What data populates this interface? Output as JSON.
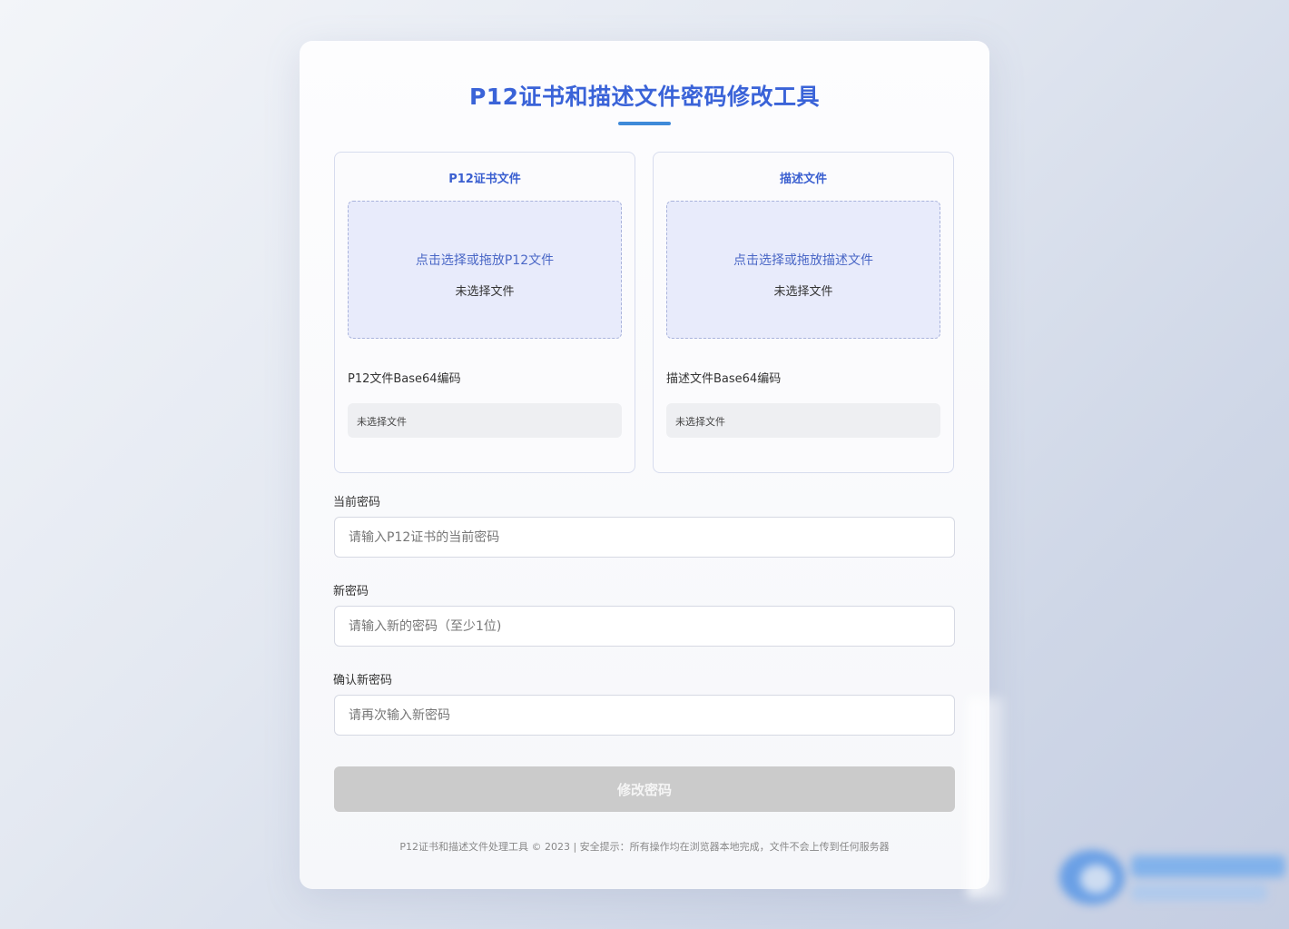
{
  "page": {
    "title": "P12证书和描述文件密码修改工具"
  },
  "p12_panel": {
    "title": "P12证书文件",
    "dropzone_hint": "点击选择或拖放P12文件",
    "dropzone_status": "未选择文件",
    "base64_label": "P12文件Base64编码",
    "base64_value": "未选择文件"
  },
  "profile_panel": {
    "title": "描述文件",
    "dropzone_hint": "点击选择或拖放描述文件",
    "dropzone_status": "未选择文件",
    "base64_label": "描述文件Base64编码",
    "base64_value": "未选择文件"
  },
  "form": {
    "current_password": {
      "label": "当前密码",
      "value": "",
      "placeholder": "请输入P12证书的当前密码"
    },
    "new_password": {
      "label": "新密码",
      "value": "",
      "placeholder": "请输入新的密码（至少1位)"
    },
    "confirm_password": {
      "label": "确认新密码",
      "value": "",
      "placeholder": "请再次输入新密码"
    },
    "submit_label": "修改密码",
    "submit_disabled": true
  },
  "footer": {
    "text": "P12证书和描述文件处理工具 © 2023 | 安全提示：所有操作均在浏览器本地完成，文件不会上传到任何服务器"
  },
  "colors": {
    "accent": "#3a63d8",
    "underline": "#3f8ad9",
    "dropzone_bg": "#e8ebfb",
    "button_disabled": "#cbcbcb"
  }
}
